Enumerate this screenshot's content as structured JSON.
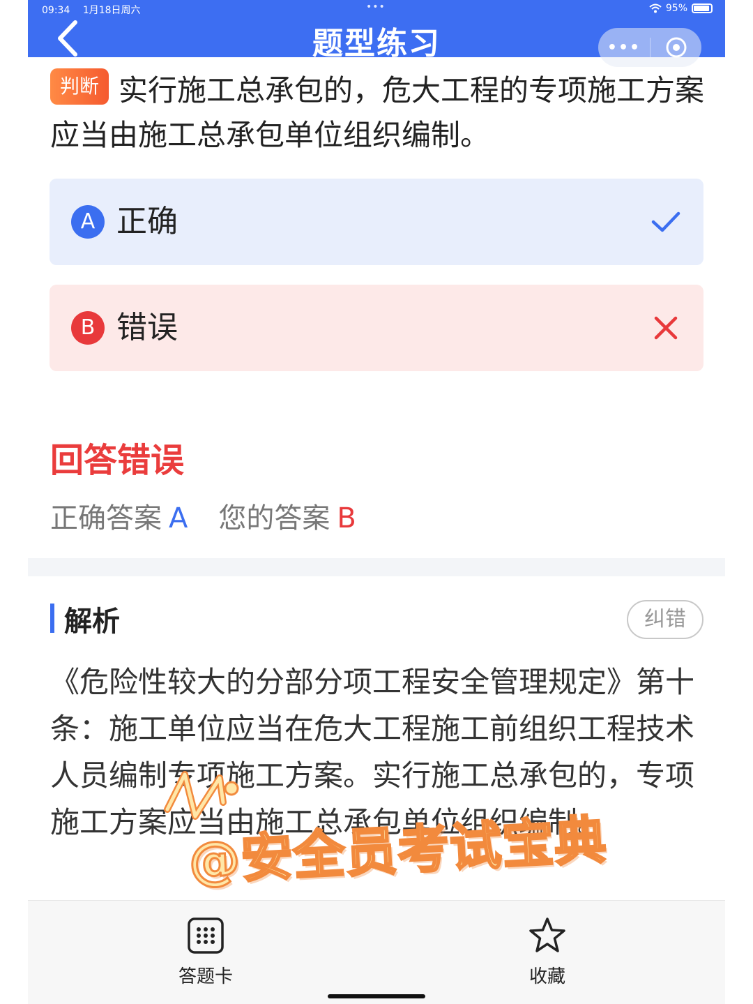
{
  "status_bar": {
    "time": "09:34",
    "date": "1月18日周六",
    "center_dots": "•••",
    "battery": "95%"
  },
  "header": {
    "title": "题型练习",
    "more_label": "•••"
  },
  "question": {
    "type_tag": "判断",
    "text": "实行施工总承包的，危大工程的专项施工方案应当由施工总承包单位组织编制。"
  },
  "options": [
    {
      "letter": "A",
      "label": "正确",
      "status": "correct"
    },
    {
      "letter": "B",
      "label": "错误",
      "status": "wrong"
    }
  ],
  "result": {
    "title": "回答错误",
    "correct_answer_label": "正确答案",
    "correct_answer": "A",
    "your_answer_label": "您的答案",
    "your_answer": "B"
  },
  "analysis": {
    "title": "解析",
    "report_button": "纠错",
    "text": "《危险性较大的分部分项工程安全管理规定》第十条：施工单位应当在危大工程施工前组织工程技术人员编制专项施工方案。实行施工总承包的，专项施工方案应当由施工总承包单位组织编制。"
  },
  "watermark": "@安全员考试宝典",
  "bottom_bar": {
    "card_label": "答题卡",
    "favorite_label": "收藏"
  },
  "colors": {
    "header": "#3d6ef2",
    "accent_blue": "#3b6ef0",
    "error_red": "#e8393b",
    "tag_orange": "#f55a2f"
  },
  "icons": [
    "back-arrow-icon",
    "more-dots-icon",
    "close-target-icon",
    "check-icon",
    "cross-icon",
    "grid-icon",
    "star-icon",
    "wifi-icon",
    "battery-icon"
  ]
}
